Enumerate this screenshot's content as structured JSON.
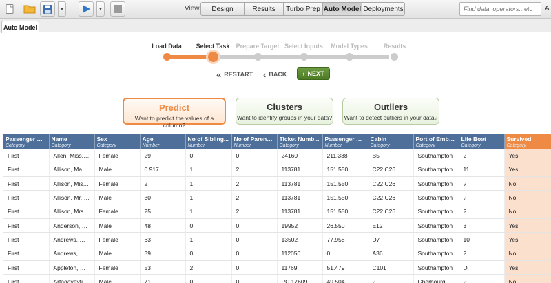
{
  "toolbar": {
    "views_label": "Views:",
    "view_tabs": [
      "Design",
      "Results",
      "Turbo Prep",
      "Auto Model",
      "Deployments"
    ],
    "active_view": "Auto Model",
    "search_placeholder": "Find data, operators...etc",
    "edge_text": "A"
  },
  "tab": {
    "label": "Auto Model"
  },
  "steps": {
    "labels": [
      "Load Data",
      "Select Task",
      "Prepare Target",
      "Select Inputs",
      "Model Types",
      "Results"
    ]
  },
  "nav": {
    "restart": "RESTART",
    "back": "BACK",
    "next": "NEXT"
  },
  "cards": [
    {
      "title": "Predict",
      "desc": "Want to predict the values of a column?"
    },
    {
      "title": "Clusters",
      "desc": "Want to identify groups in your data?"
    },
    {
      "title": "Outliers",
      "desc": "Want to detect outliers in your data?"
    }
  ],
  "table": {
    "columns": [
      {
        "name": "Passenger Cl...",
        "type": "Category"
      },
      {
        "name": "Name",
        "type": "Category"
      },
      {
        "name": "Sex",
        "type": "Category"
      },
      {
        "name": "Age",
        "type": "Number"
      },
      {
        "name": "No of Sibling...",
        "type": "Number"
      },
      {
        "name": "No of Parents...",
        "type": "Number"
      },
      {
        "name": "Ticket Numb...",
        "type": "Category"
      },
      {
        "name": "Passenger Fa...",
        "type": "Number"
      },
      {
        "name": "Cabin",
        "type": "Category"
      },
      {
        "name": "Port of Emba...",
        "type": "Category"
      },
      {
        "name": "Life Boat",
        "type": "Category"
      },
      {
        "name": "Survived",
        "type": "Category"
      }
    ],
    "rows": [
      [
        "First",
        "Allen, Miss. Eli...",
        "Female",
        "29",
        "0",
        "0",
        "24160",
        "211.338",
        "B5",
        "Southampton",
        "2",
        "Yes"
      ],
      [
        "First",
        "Allison, Master...",
        "Male",
        "0.917",
        "1",
        "2",
        "113781",
        "151.550",
        "C22 C26",
        "Southampton",
        "11",
        "Yes"
      ],
      [
        "First",
        "Allison, Miss. ...",
        "Female",
        "2",
        "1",
        "2",
        "113781",
        "151.550",
        "C22 C26",
        "Southampton",
        "?",
        "No"
      ],
      [
        "First",
        "Allison, Mr. Hu...",
        "Male",
        "30",
        "1",
        "2",
        "113781",
        "151.550",
        "C22 C26",
        "Southampton",
        "?",
        "No"
      ],
      [
        "First",
        "Allison, Mrs. H...",
        "Female",
        "25",
        "1",
        "2",
        "113781",
        "151.550",
        "C22 C26",
        "Southampton",
        "?",
        "No"
      ],
      [
        "First",
        "Anderson, Mr....",
        "Male",
        "48",
        "0",
        "0",
        "19952",
        "26.550",
        "E12",
        "Southampton",
        "3",
        "Yes"
      ],
      [
        "First",
        "Andrews, Miss...",
        "Female",
        "63",
        "1",
        "0",
        "13502",
        "77.958",
        "D7",
        "Southampton",
        "10",
        "Yes"
      ],
      [
        "First",
        "Andrews, Mr. ...",
        "Male",
        "39",
        "0",
        "0",
        "112050",
        "0",
        "A36",
        "Southampton",
        "?",
        "No"
      ],
      [
        "First",
        "Appleton, Mrs....",
        "Female",
        "53",
        "2",
        "0",
        "11769",
        "51.479",
        "C101",
        "Southampton",
        "D",
        "Yes"
      ],
      [
        "First",
        "Artagaveytia, ...",
        "Male",
        "71",
        "0",
        "0",
        "PC 17609",
        "49.504",
        "?",
        "Cherbourg",
        "?",
        "No"
      ]
    ]
  },
  "colors": {
    "accent": "#ef8a45",
    "header": "#4e6f99",
    "next": "#5a8a2f"
  }
}
